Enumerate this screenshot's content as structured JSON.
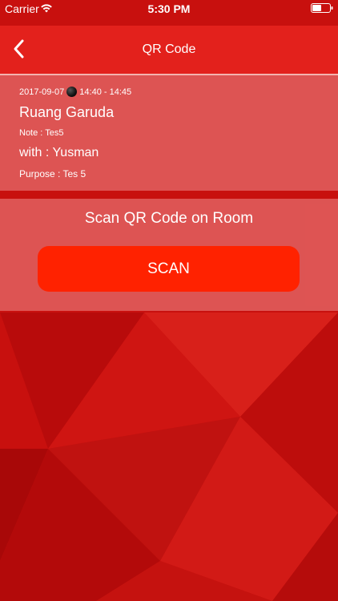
{
  "status_bar": {
    "carrier": "Carrier",
    "time": "5:30 PM",
    "wifi_icon": "wifi-icon",
    "battery_icon": "battery-icon"
  },
  "nav": {
    "title": "QR Code",
    "back_icon": "chevron-left-icon"
  },
  "booking": {
    "date": "2017-09-07",
    "time_range": "14:40 - 14:45",
    "room": "Ruang Garuda",
    "note": "Note : Tes5",
    "with": "with : Yusman",
    "purpose": "Purpose : Tes 5"
  },
  "scan": {
    "title": "Scan QR Code on Room",
    "button_label": "SCAN"
  },
  "colors": {
    "background": "#c8100e",
    "nav_bar": "#e3211c",
    "card_overlay": "#e87474",
    "scan_button": "#ff2200",
    "text": "#ffffff"
  }
}
